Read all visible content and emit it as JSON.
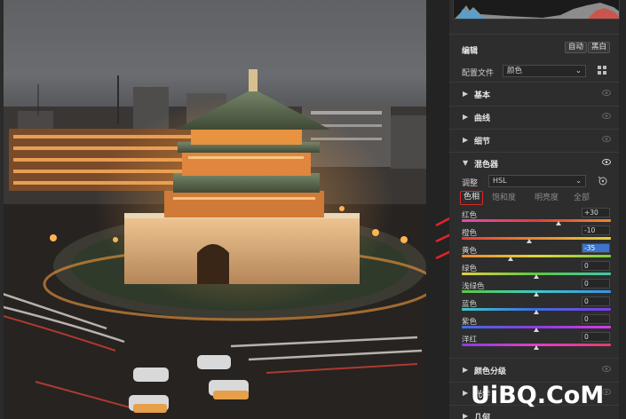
{
  "editor": {
    "edit_title": "编辑",
    "auto_label": "自动",
    "bw_label": "黑白",
    "profile_label": "配置文件",
    "profile_value": "颜色"
  },
  "sections": {
    "basic": "基本",
    "curve": "曲线",
    "detail": "细节",
    "mixer": "混色器",
    "color_grading": "颜色分级",
    "optics": "光学",
    "geometry": "几何"
  },
  "mixer": {
    "adjust_label": "调整",
    "adjust_value": "HSL",
    "tabs": [
      "色相",
      "饱和度",
      "明亮度",
      "全部"
    ],
    "active_tab": 0,
    "sliders": [
      {
        "name": "红色",
        "value": "+30",
        "level": 0.65
      },
      {
        "name": "橙色",
        "value": "-10",
        "level": 0.45
      },
      {
        "name": "黄色",
        "value": "-35",
        "level": 0.325,
        "selected": true
      },
      {
        "name": "绿色",
        "value": "0",
        "level": 0.5
      },
      {
        "name": "浅绿色",
        "value": "0",
        "level": 0.5
      },
      {
        "name": "蓝色",
        "value": "0",
        "level": 0.5
      },
      {
        "name": "紫色",
        "value": "0",
        "level": 0.5
      },
      {
        "name": "洋红",
        "value": "0",
        "level": 0.5
      }
    ]
  },
  "colors": {
    "accent_red": "#e0242a",
    "selection_blue": "#3b74c9"
  },
  "watermark": "UiBQ.CoM"
}
